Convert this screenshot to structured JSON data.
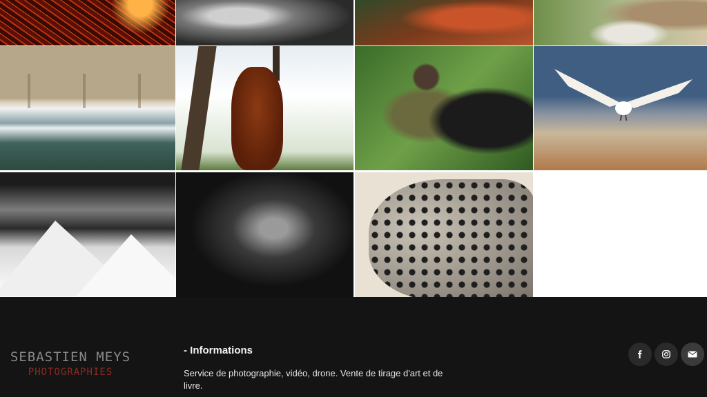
{
  "gallery": {
    "images": [
      {
        "name": "lava-photo"
      },
      {
        "name": "animal-ear-photo"
      },
      {
        "name": "river-photo"
      },
      {
        "name": "animal-paw-photo"
      },
      {
        "name": "coastline-aerial-photo"
      },
      {
        "name": "orangutan-photo"
      },
      {
        "name": "man-with-gorilla-photo"
      },
      {
        "name": "white-bird-photo"
      },
      {
        "name": "snowy-mountain-photo"
      },
      {
        "name": "gorilla-portrait-photo"
      },
      {
        "name": "jaguar-photo"
      }
    ]
  },
  "footer": {
    "brand_name": "SEBASTIEN MEYS",
    "brand_sub": "PHOTOGRAPHIES",
    "info_title": "- Informations",
    "info_text": "Service de photographie, vidéo, drone. Vente de tirage d'art et de livre.",
    "social": [
      {
        "icon": "facebook-icon"
      },
      {
        "icon": "instagram-icon"
      },
      {
        "icon": "email-icon"
      }
    ]
  },
  "colors": {
    "footer_bg": "#141414",
    "brand_red": "#8e2a22"
  }
}
